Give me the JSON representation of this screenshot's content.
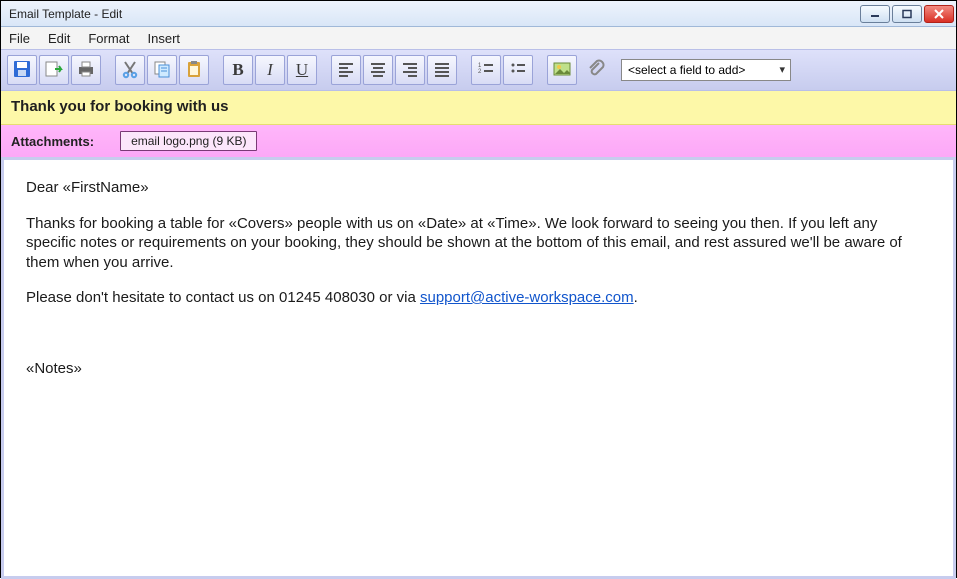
{
  "window": {
    "title": "Email Template - Edit"
  },
  "menu": {
    "file": "File",
    "edit": "Edit",
    "format": "Format",
    "insert": "Insert"
  },
  "toolbar": {
    "field_selector": "<select a field to add>"
  },
  "icons": {
    "save": "save-icon",
    "savego": "save-next-icon",
    "print": "print-icon",
    "cut": "cut-icon",
    "copy": "copy-icon",
    "paste": "paste-icon",
    "bold": "B",
    "italic": "I",
    "underline": "U",
    "alignL": "align-left-icon",
    "alignC": "align-center-icon",
    "alignR": "align-right-icon",
    "alignJ": "align-justify-icon",
    "numlist": "numbered-list-icon",
    "bulllist": "bullet-list-icon",
    "image": "image-icon",
    "attach": "attach-icon"
  },
  "subject": "Thank you for booking with us",
  "attachments": {
    "label": "Attachments:",
    "items": [
      "email logo.png (9 KB)"
    ]
  },
  "body": {
    "greeting": "Dear «FirstName»",
    "para1_a": "Thanks for booking a table for «Covers» people with us on «Date» at «Time». We look forward to seeing you then. If you left any specific notes or requirements on your booking, they should be shown at the bottom of this email, and rest assured we'll be aware of them when you arrive.",
    "para2_a": "Please don't hesitate to contact us on 01245 408030 or via ",
    "para2_link": "support@active-workspace.com",
    "para2_b": ".",
    "notes": "«Notes»"
  }
}
